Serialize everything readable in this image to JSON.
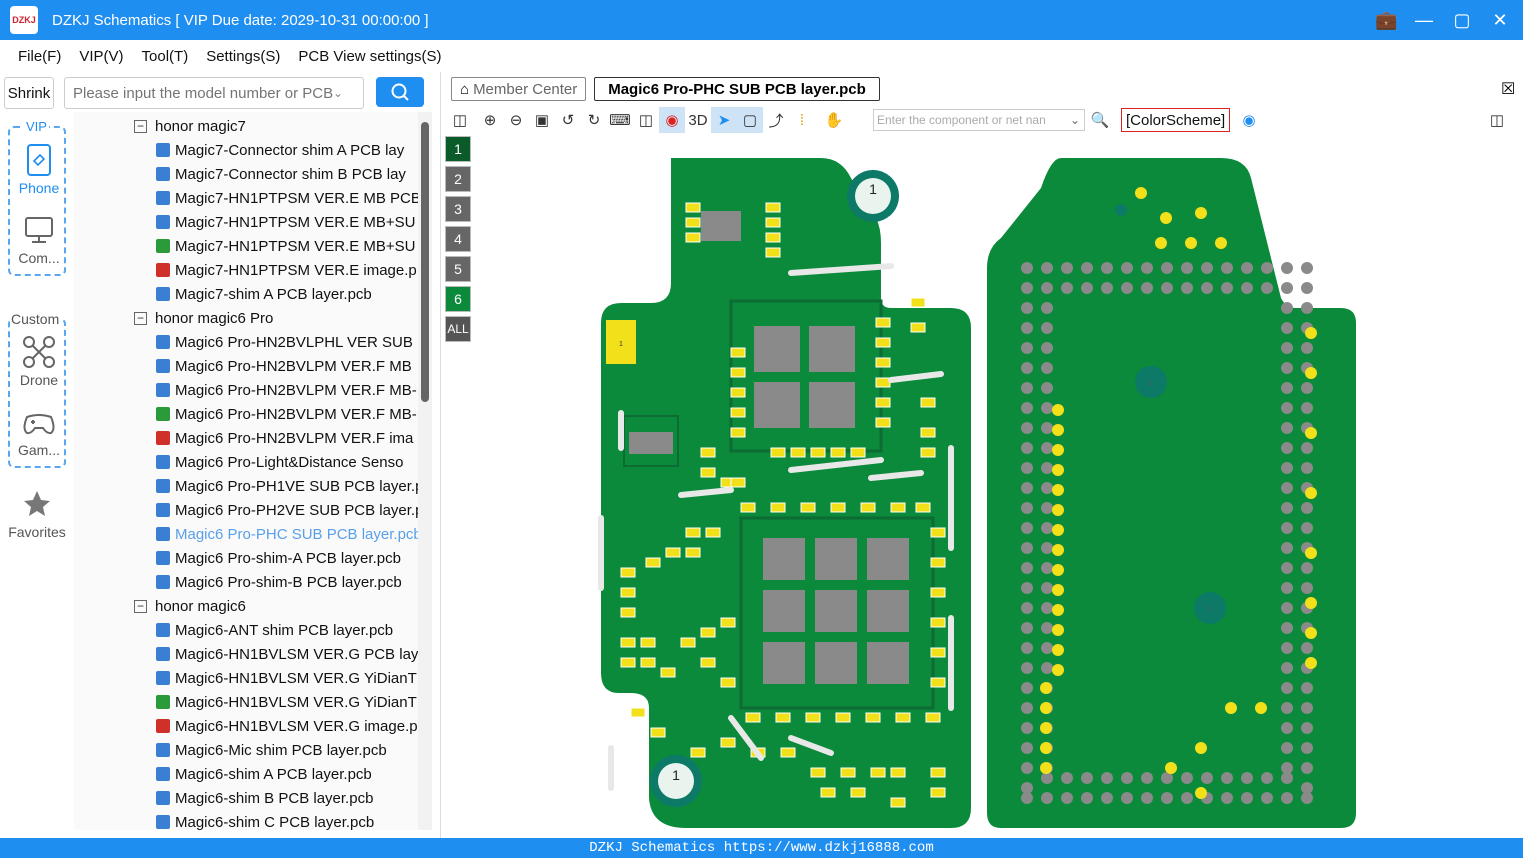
{
  "window": {
    "title": "DZKJ Schematics [ VIP Due date: 2029-10-31 00:00:00 ]",
    "logo_text": "DZKJ"
  },
  "menu": [
    "File(F)",
    "VIP(V)",
    "Tool(T)",
    "Settings(S)",
    "PCB View settings(S)"
  ],
  "sidebar": {
    "shrink_label": "Shrink",
    "search_placeholder": "Please input the model number or PCB",
    "vip_label": "VIP",
    "custom_label": "Custom",
    "items": [
      {
        "label": "Phone",
        "icon": "phone-icon"
      },
      {
        "label": "Com...",
        "icon": "computer-icon"
      },
      {
        "label": "Drone",
        "icon": "drone-icon"
      },
      {
        "label": "Gam...",
        "icon": "gamepad-icon"
      },
      {
        "label": "Favorites",
        "icon": "star-icon"
      }
    ]
  },
  "tree": [
    {
      "type": "group",
      "label": "honor magic7"
    },
    {
      "type": "file",
      "kind": "pcb",
      "label": "Magic7-Connector shim A PCB lay"
    },
    {
      "type": "file",
      "kind": "pcb",
      "label": "Magic7-Connector shim B PCB lay"
    },
    {
      "type": "file",
      "kind": "pcb",
      "label": "Magic7-HN1PTPSM VER.E MB PCB"
    },
    {
      "type": "file",
      "kind": "pcb",
      "label": "Magic7-HN1PTPSM VER.E MB+SU"
    },
    {
      "type": "file",
      "kind": "img",
      "label": "Magic7-HN1PTPSM VER.E MB+SU"
    },
    {
      "type": "file",
      "kind": "pdf",
      "label": "Magic7-HN1PTPSM VER.E image.p"
    },
    {
      "type": "file",
      "kind": "pcb",
      "label": "Magic7-shim A PCB layer.pcb"
    },
    {
      "type": "group",
      "label": "honor magic6 Pro"
    },
    {
      "type": "file",
      "kind": "pcb",
      "label": "Magic6 Pro-HN2BVLPHL VER SUB"
    },
    {
      "type": "file",
      "kind": "pcb",
      "label": "Magic6 Pro-HN2BVLPM VER.F MB"
    },
    {
      "type": "file",
      "kind": "pcb",
      "label": "Magic6 Pro-HN2BVLPM VER.F MB-"
    },
    {
      "type": "file",
      "kind": "img",
      "label": "Magic6 Pro-HN2BVLPM VER.F MB-"
    },
    {
      "type": "file",
      "kind": "pdf",
      "label": "Magic6 Pro-HN2BVLPM VER.F ima"
    },
    {
      "type": "file",
      "kind": "pcb",
      "label": "Magic6 Pro-Light&Distance Senso"
    },
    {
      "type": "file",
      "kind": "pcb",
      "label": "Magic6 Pro-PH1VE SUB PCB layer.p"
    },
    {
      "type": "file",
      "kind": "pcb",
      "label": "Magic6 Pro-PH2VE SUB PCB layer.p"
    },
    {
      "type": "file",
      "kind": "pcb",
      "label": "Magic6 Pro-PHC SUB PCB layer.pcb",
      "selected": true
    },
    {
      "type": "file",
      "kind": "pcb",
      "label": "Magic6 Pro-shim-A PCB layer.pcb"
    },
    {
      "type": "file",
      "kind": "pcb",
      "label": "Magic6 Pro-shim-B PCB layer.pcb"
    },
    {
      "type": "group",
      "label": "honor magic6"
    },
    {
      "type": "file",
      "kind": "pcb",
      "label": "Magic6-ANT shim PCB layer.pcb"
    },
    {
      "type": "file",
      "kind": "pcb",
      "label": "Magic6-HN1BVLSM VER.G PCB lay"
    },
    {
      "type": "file",
      "kind": "pcb",
      "label": "Magic6-HN1BVLSM VER.G YiDianT"
    },
    {
      "type": "file",
      "kind": "img",
      "label": "Magic6-HN1BVLSM VER.G YiDianT"
    },
    {
      "type": "file",
      "kind": "pdf",
      "label": "Magic6-HN1BVLSM VER.G image.p"
    },
    {
      "type": "file",
      "kind": "pcb",
      "label": "Magic6-Mic shim PCB layer.pcb"
    },
    {
      "type": "file",
      "kind": "pcb",
      "label": "Magic6-shim A PCB layer.pcb"
    },
    {
      "type": "file",
      "kind": "pcb",
      "label": "Magic6-shim B PCB layer.pcb"
    },
    {
      "type": "file",
      "kind": "pcb",
      "label": "Magic6-shim C PCB layer.pcb"
    }
  ],
  "tabs": {
    "member_center": "Member Center",
    "active_file": "Magic6 Pro-PHC SUB PCB layer.pcb"
  },
  "viewer": {
    "three_d_label": "3D",
    "component_placeholder": "Enter the component or net nan",
    "color_scheme_label": "[ColorScheme]",
    "layers": [
      "1",
      "2",
      "3",
      "4",
      "5",
      "6",
      "ALL"
    ],
    "board_markers": [
      "1",
      "1",
      "1",
      "1",
      "1"
    ]
  },
  "status": "DZKJ Schematics https://www.dzkj16888.com",
  "colors": {
    "accent": "#1f8ef1",
    "pcb_green": "#0a8a3a",
    "pad_yellow": "#f2e01a",
    "pad_gray": "#8a8a8a"
  }
}
